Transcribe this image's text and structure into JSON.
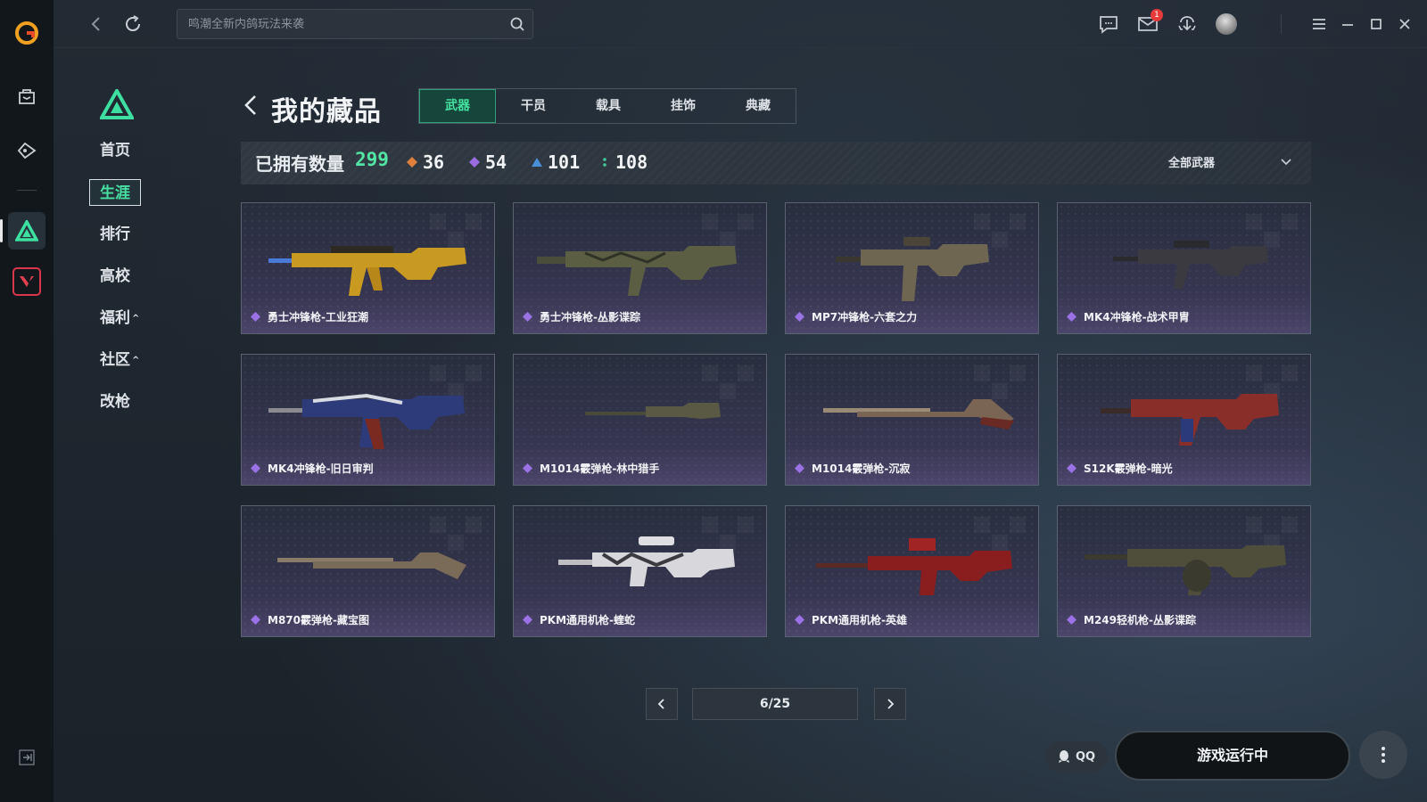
{
  "search": {
    "placeholder": "鸣潮全新内鸽玩法来袭"
  },
  "topbar": {
    "mail_badge": "1"
  },
  "sidenav": {
    "items": [
      {
        "label": "首页"
      },
      {
        "label": "生涯"
      },
      {
        "label": "排行"
      },
      {
        "label": "高校"
      },
      {
        "label": "福利"
      },
      {
        "label": "社区"
      },
      {
        "label": "改枪"
      }
    ]
  },
  "header": {
    "title": "我的藏品",
    "tabs": [
      {
        "label": "武器"
      },
      {
        "label": "干员"
      },
      {
        "label": "载具"
      },
      {
        "label": "挂饰"
      },
      {
        "label": "典藏"
      }
    ]
  },
  "stats": {
    "owned_label": "已拥有数量",
    "owned_total": "299",
    "rarities": [
      {
        "value": "36",
        "color": "#e0803a"
      },
      {
        "value": "54",
        "color": "#9a6ce0"
      },
      {
        "value": "101",
        "color": "#4a90d9"
      },
      {
        "value": "108",
        "color": "#44c99a"
      }
    ],
    "filter_label": "全部武器"
  },
  "items": [
    {
      "name": "勇士冲锋枪-工业狂潮"
    },
    {
      "name": "勇士冲锋枪-丛影谍踪"
    },
    {
      "name": "MP7冲锋枪-六套之力"
    },
    {
      "name": "MK4冲锋枪-战术甲胄"
    },
    {
      "name": "MK4冲锋枪-旧日审判"
    },
    {
      "name": "M1014霰弹枪-林中猎手"
    },
    {
      "name": "M1014霰弹枪-沉寂"
    },
    {
      "name": "S12K霰弹枪-暗光"
    },
    {
      "name": "M870霰弹枪-藏宝图"
    },
    {
      "name": "PKM通用机枪-蝰蛇"
    },
    {
      "name": "PKM通用机枪-英雄"
    },
    {
      "name": "M249轻机枪-丛影谍踪"
    }
  ],
  "pager": {
    "info": "6/25"
  },
  "footer": {
    "qq_label": "QQ",
    "play_label": "游戏运行中"
  }
}
